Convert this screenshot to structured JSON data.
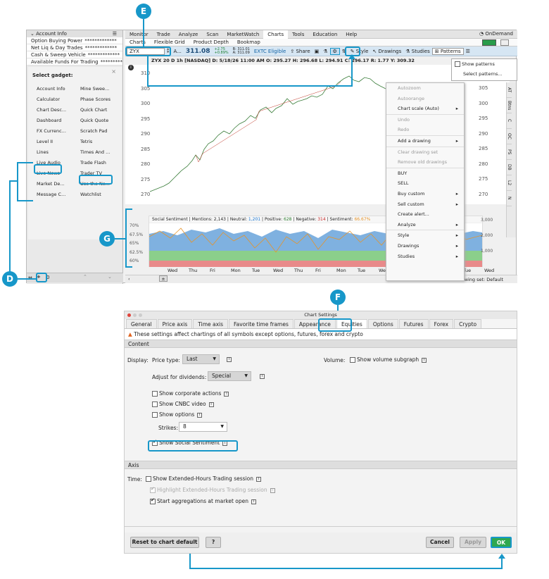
{
  "callouts": {
    "e": "E",
    "d": "D",
    "f": "F",
    "g": "G"
  },
  "account_info": {
    "header": "Account Info",
    "rows": [
      {
        "label": "Option Buying Power",
        "value": "*************"
      },
      {
        "label": "Net Liq & Day Trades",
        "value": "*************"
      },
      {
        "label": "Cash & Sweep Vehicle",
        "value": "*************"
      },
      {
        "label": "Available Funds For Trading",
        "value": "*************"
      }
    ]
  },
  "gadget": {
    "title": "Select gadget:",
    "items": [
      "Account Info",
      "Mine Swee...",
      "Calculator",
      "Phase Scores",
      "Chart Desc...",
      "Quick Chart",
      "Dashboard",
      "Quick Quote",
      "FX Currenc...",
      "Scratch Pad",
      "Level II",
      "Tetris",
      "Lines",
      "Times And ...",
      "Live Audio",
      "Trade Flash",
      "Live News",
      "Trader TV",
      "Market De...",
      "Use the Ne...",
      "Message C...",
      "Watchlist"
    ],
    "bottom_value": "0"
  },
  "menubar": [
    "Monitor",
    "Trade",
    "Analyze",
    "Scan",
    "MarketWatch",
    "Charts",
    "Tools",
    "Education",
    "Help"
  ],
  "menubar_active": "Charts",
  "ondemand": "OnDemand",
  "subbar": [
    "Charts",
    "Flexible Grid",
    "Product Depth",
    "Bookmap"
  ],
  "toolbar": {
    "symbol": "ZYX",
    "price": "311.08",
    "change1": "+2.75",
    "change2": "+0.89%",
    "bid": "B: 311.01",
    "ask": "A: 311.09",
    "extc": "EXTC Eligible",
    "share": "Share",
    "style": "Style",
    "drawings": "Drawings",
    "studies": "Studies",
    "patterns": "Patterns"
  },
  "chart_info": "ZYX 20 D 1h [NASDAQ] D: 5/18/26 11:00 AM O: 295.27 H: 296.68 L: 294.91 C: 296.17 R: 1.77 Y: 309.32",
  "y_ticks_left": [
    "310",
    "305",
    "300",
    "295",
    "290",
    "285",
    "280",
    "275",
    "270"
  ],
  "y_ticks_right": [
    "305",
    "300",
    "295",
    "290",
    "285",
    "280",
    "275",
    "270"
  ],
  "sentiment": {
    "label": "Social Sentiment",
    "mentions": "Mentions: 2,143",
    "neutral_label": "Neutral:",
    "neutral": "1,201",
    "positive_label": "Positive:",
    "positive": "628",
    "negative_label": "Negative:",
    "negative": "314",
    "sentiment_label": "Sentiment:",
    "sentiment": "66.67%",
    "y_ticks": [
      "70%",
      "67.5%",
      "65%",
      "62.5%",
      "60%"
    ],
    "y_ticks_right": [
      "3,000",
      "2,000",
      "1,000"
    ]
  },
  "x_ticks": [
    "Wed",
    "Thu",
    "Fri",
    "Mon",
    "Tue",
    "Wed",
    "Thu",
    "Fri",
    "Mon",
    "Tue",
    "Wed",
    "Thu",
    "Fri",
    "Mon",
    "Tue",
    "Wed"
  ],
  "drawing_set": "Drawing set: Default",
  "context_menu": [
    {
      "label": "Autozoom",
      "dis": true
    },
    {
      "label": "Autoorange",
      "dis": true
    },
    {
      "label": "Chart scale (Auto)",
      "arrow": true
    },
    "sep",
    {
      "label": "Undo",
      "dis": true
    },
    {
      "label": "Redo",
      "dis": true
    },
    "sep",
    {
      "label": "Add a drawing",
      "arrow": true
    },
    "sep",
    {
      "label": "Clear drawing set",
      "dis": true
    },
    {
      "label": "Remove old drawings",
      "dis": true
    },
    "sep",
    {
      "label": "BUY"
    },
    {
      "label": "SELL"
    },
    {
      "label": "Buy custom",
      "arrow": true
    },
    {
      "label": "Sell custom",
      "arrow": true
    },
    {
      "label": "Create alert..."
    },
    {
      "label": "Analyze",
      "arrow": true
    },
    "sep",
    {
      "label": "Style",
      "arrow": true
    },
    {
      "label": "Drawings",
      "arrow": true
    },
    {
      "label": "Studies",
      "arrow": true
    }
  ],
  "patterns_menu": {
    "show": "Show patterns",
    "select": "Select patterns..."
  },
  "right_tabs": [
    "AT",
    "Btns",
    "C",
    "OC",
    "PS",
    "DB",
    "L2",
    "N"
  ],
  "dialog": {
    "title": "Chart Settings",
    "tabs": [
      "General",
      "Price axis",
      "Time axis",
      "Favorite time frames",
      "Appearance",
      "Equities",
      "Options",
      "Futures",
      "Forex",
      "Crypto"
    ],
    "selected_tab": "Equities",
    "warning": "These settings affect chartings of all symbols except options, futures, forex and crypto",
    "content_header": "Content",
    "display_label": "Display:",
    "price_type_label": "Price type:",
    "price_type": "Last",
    "volume_label": "Volume:",
    "show_volume": "Show volume subgraph",
    "adjust_label": "Adjust for dividends:",
    "adjust_value": "Special",
    "corp": "Show corporate actions",
    "cnbc": "Show CNBC video",
    "options": "Show options",
    "strikes_label": "Strikes:",
    "strikes": "8",
    "social": "Show Social Sentiment",
    "axis_header": "Axis",
    "time_label": "Time:",
    "ext": "Show Extended-Hours Trading session",
    "highlight": "Highlight Extended-Hours Trading session",
    "aggr": "Start aggregations at market open",
    "reset": "Reset to chart default",
    "help": "?",
    "cancel": "Cancel",
    "apply": "Apply",
    "ok": "OK"
  }
}
